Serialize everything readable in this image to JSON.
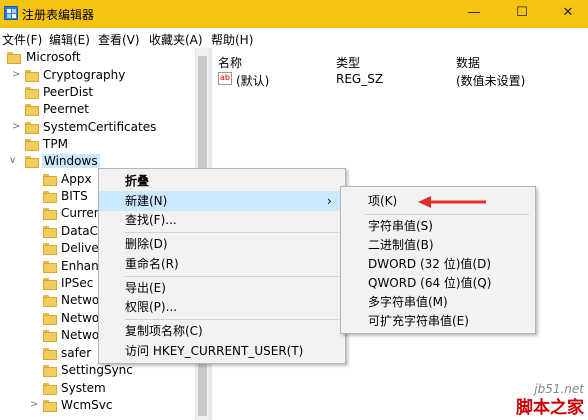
{
  "window": {
    "title": "注册表编辑器",
    "controls": [
      "—",
      "☐",
      "✕"
    ],
    "title_bar_color": "#f6c410"
  },
  "menubar": [
    "文件(F)",
    "编辑(E)",
    "查看(V)",
    "收藏夹(A)",
    "帮助(H)"
  ],
  "tree": {
    "items": [
      {
        "label": "Microsoft",
        "expander": ""
      },
      {
        "label": "Cryptography",
        "expander": ">"
      },
      {
        "label": "PeerDist",
        "expander": ""
      },
      {
        "label": "Peernet",
        "expander": ""
      },
      {
        "label": "SystemCertificates",
        "expander": ">"
      },
      {
        "label": "TPM",
        "expander": ""
      },
      {
        "label": "Windows",
        "expander": "∨"
      },
      {
        "label": "Appx",
        "expander": ""
      },
      {
        "label": "BITS",
        "expander": ""
      },
      {
        "label": "Curren",
        "expander": ""
      },
      {
        "label": "DataC",
        "expander": ""
      },
      {
        "label": "Delive",
        "expander": ""
      },
      {
        "label": "Enhan",
        "expander": ""
      },
      {
        "label": "IPSec",
        "expander": ""
      },
      {
        "label": "Netwo",
        "expander": ""
      },
      {
        "label": "Netwo",
        "expander": ""
      },
      {
        "label": "Netwo",
        "expander": ""
      },
      {
        "label": "safer",
        "expander": ""
      },
      {
        "label": "SettingSync",
        "expander": ""
      },
      {
        "label": "System",
        "expander": ""
      },
      {
        "label": "WcmSvc",
        "expander": ">"
      }
    ]
  },
  "list": {
    "headers": [
      "名称",
      "类型",
      "数据"
    ],
    "rows": [
      {
        "icon": "ab",
        "name": "(默认)",
        "type": "REG_SZ",
        "data": "(数值未设置)"
      }
    ]
  },
  "context_menu": {
    "items": [
      "折叠",
      "新建(N)",
      "查找(F)...",
      "删除(D)",
      "重命名(R)",
      "导出(E)",
      "权限(P)...",
      "复制项名称(C)",
      "访问 HKEY_CURRENT_USER(T)"
    ],
    "submenu_arrow": "›"
  },
  "submenu": {
    "items": [
      "项(K)",
      "字符串值(S)",
      "二进制值(B)",
      "DWORD (32 位)值(D)",
      "QWORD (64 位)值(Q)",
      "多字符串值(M)",
      "可扩充字符串值(E)"
    ]
  },
  "watermark": {
    "line1": "jb51.net",
    "line2": "脚本之家"
  }
}
